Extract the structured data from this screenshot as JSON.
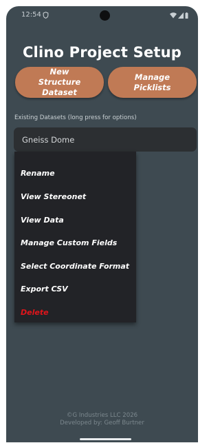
{
  "status_bar": {
    "time": "12:54",
    "icons": [
      "shield-icon",
      "wifi-icon",
      "signal-icon",
      "battery-icon"
    ]
  },
  "header": {
    "title": "Clino Project Setup"
  },
  "actions": {
    "new_structure_dataset": "New Structure Dataset",
    "manage_picklists": "Manage Picklists"
  },
  "datasets": {
    "label": "Existing Datasets (long press for options)",
    "selected": "Gneiss Dome"
  },
  "context_menu": {
    "items": [
      {
        "label": "Rename"
      },
      {
        "label": "View Stereonet"
      },
      {
        "label": "View Data"
      },
      {
        "label": "Manage Custom Fields"
      },
      {
        "label": "Select Coordinate Format"
      },
      {
        "label": "Export CSV"
      },
      {
        "label": "Delete"
      }
    ],
    "danger_color": "#e0151b"
  },
  "footer": {
    "line1": "©G Industries LLC 2026",
    "line2": "Developed by: Geoff Burtner"
  },
  "colors": {
    "background": "#3e4a51",
    "accent_button": "#c07a55",
    "menu_background": "#222327"
  }
}
